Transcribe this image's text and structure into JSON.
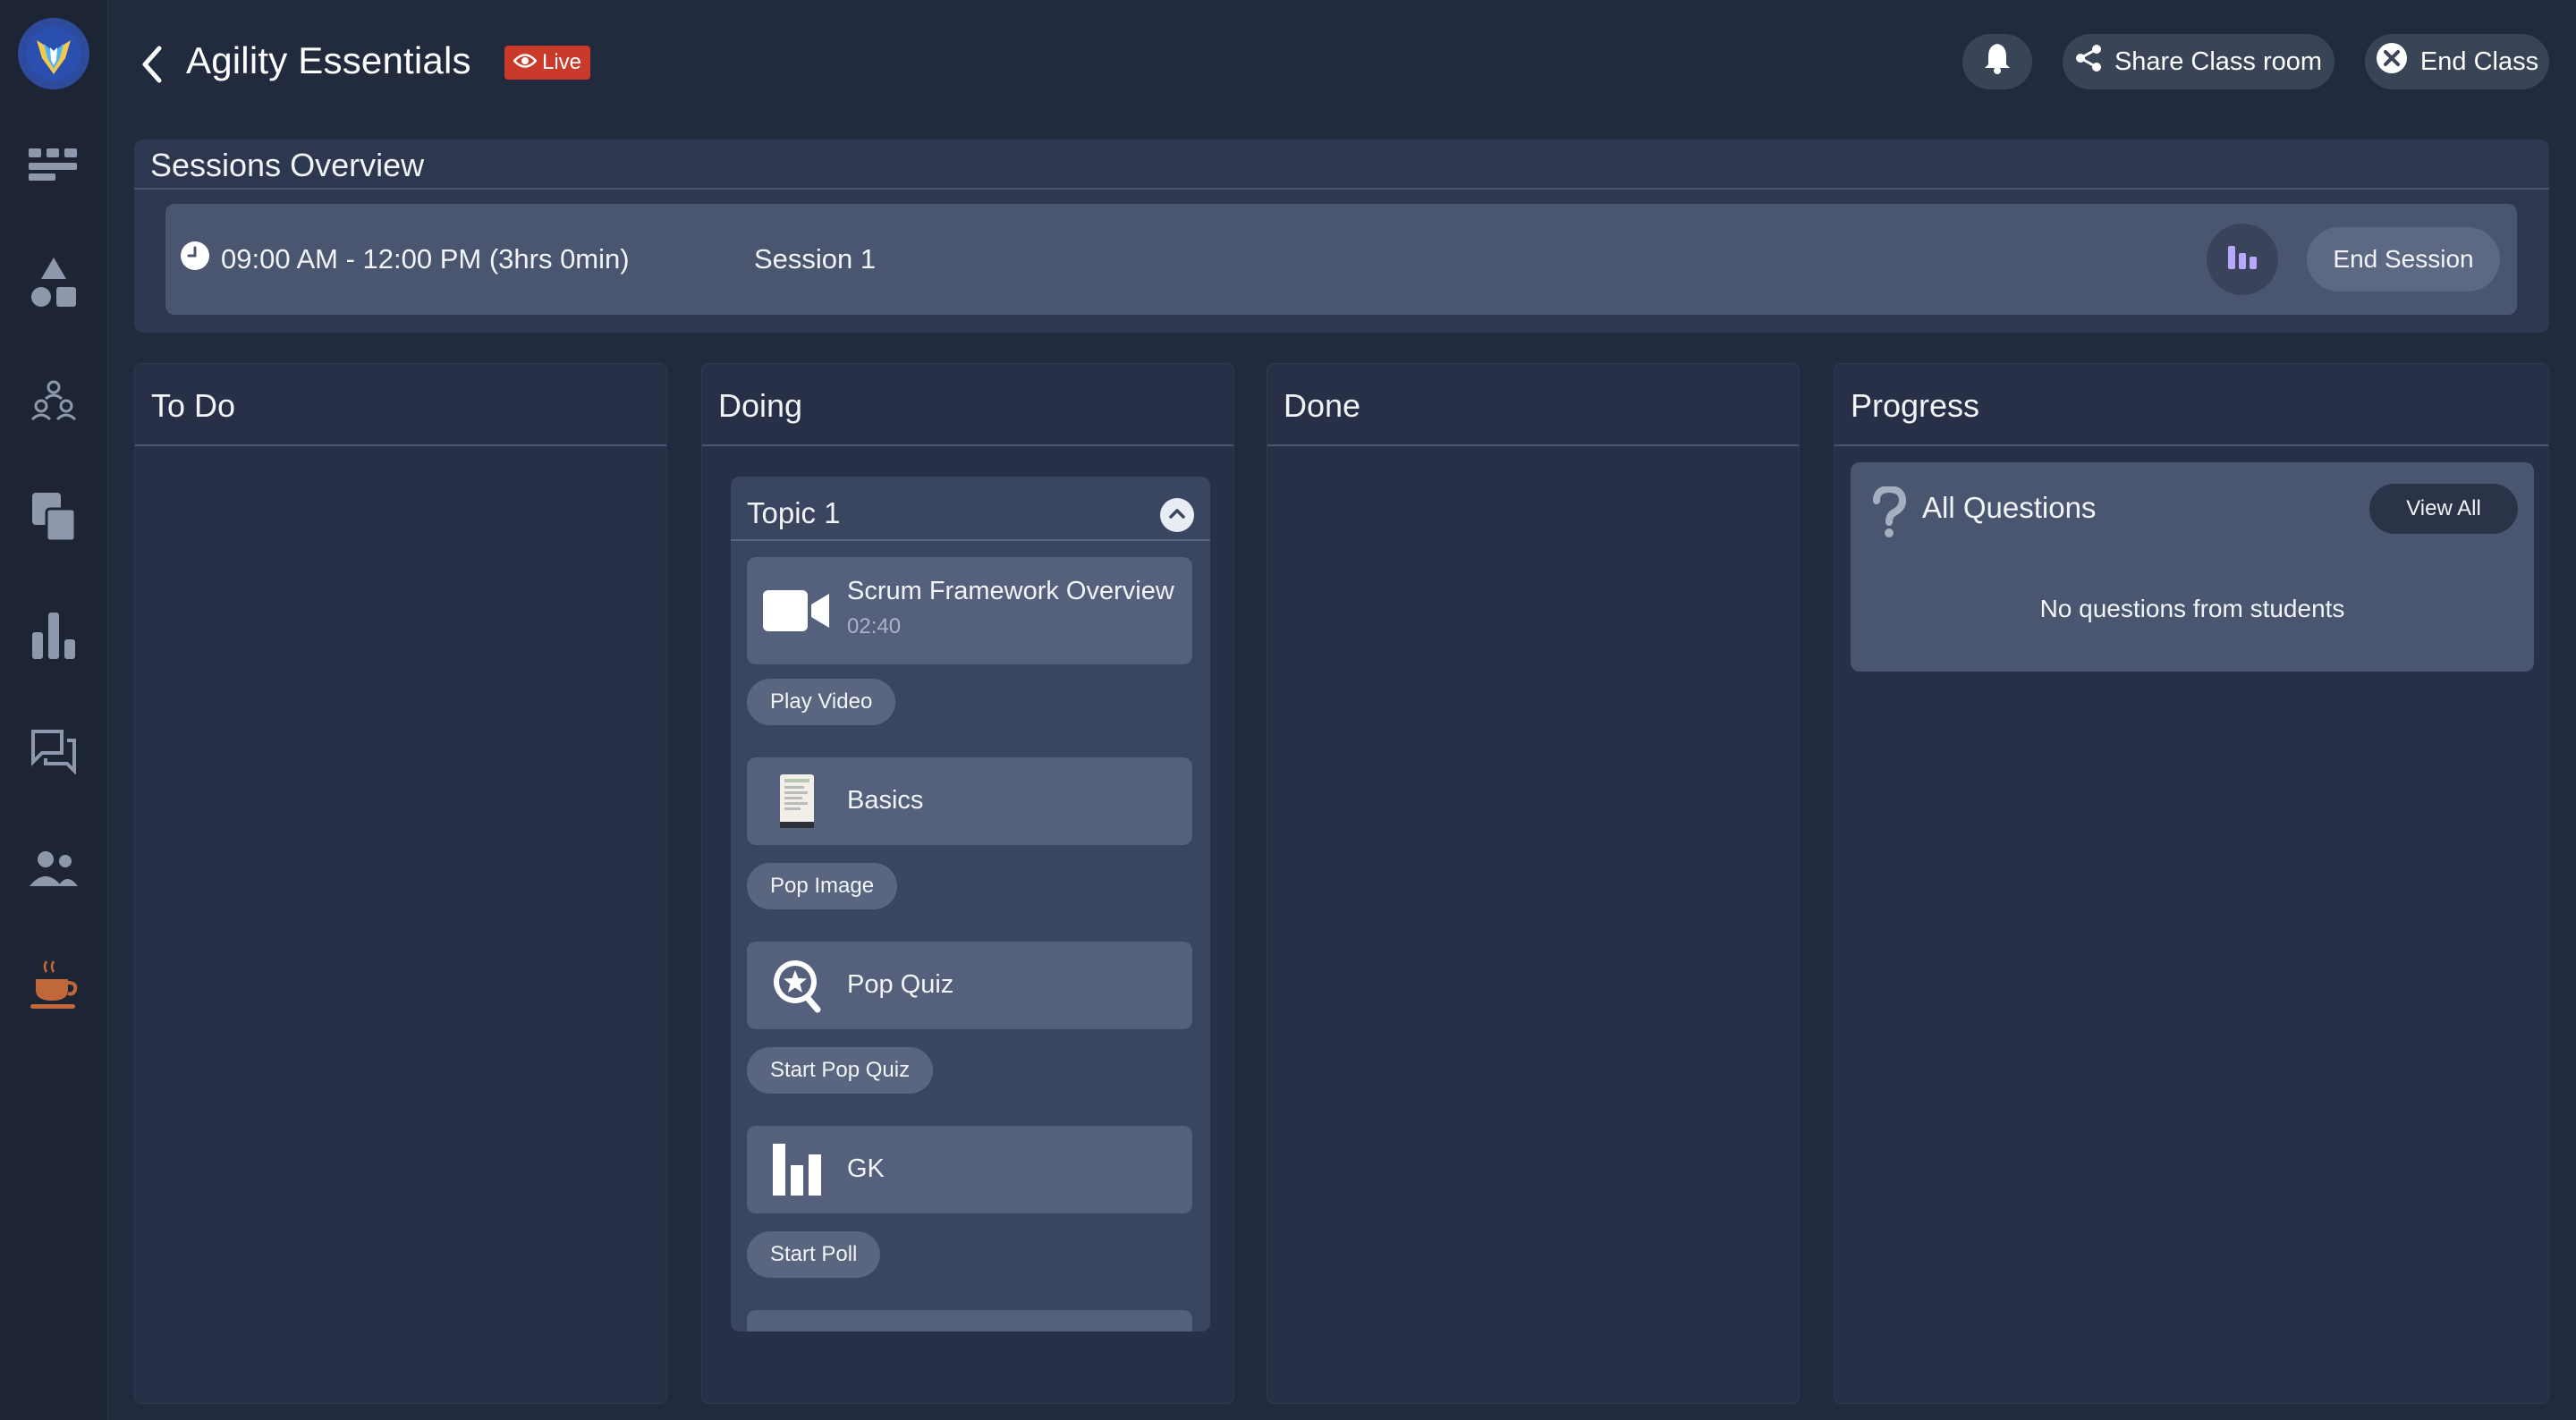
{
  "header": {
    "title": "Agility Essentials",
    "live_label": "Live",
    "share_label": "Share Class room",
    "end_class_label": "End Class"
  },
  "sidebar": {
    "items": [
      {
        "icon": "dashboard-icon"
      },
      {
        "icon": "shapes-icon"
      },
      {
        "icon": "groups-icon"
      },
      {
        "icon": "copy-icon"
      },
      {
        "icon": "bar-chart-icon"
      },
      {
        "icon": "chat-icon"
      },
      {
        "icon": "people-icon"
      },
      {
        "icon": "coffee-break-icon"
      }
    ]
  },
  "sessions": {
    "title": "Sessions Overview",
    "time": "09:00 AM - 12:00 PM (3hrs 0min)",
    "name": "Session 1",
    "end_label": "End Session"
  },
  "columns": {
    "todo": "To Do",
    "doing": "Doing",
    "done": "Done",
    "progress": "Progress"
  },
  "topic": {
    "title": "Topic 1",
    "items": [
      {
        "icon": "video-camera-icon",
        "label": "Scrum Framework Overview",
        "duration": "02:40",
        "action": "Play Video"
      },
      {
        "icon": "document-thumbnail-icon",
        "label": "Basics",
        "action": "Pop Image"
      },
      {
        "icon": "quiz-star-icon",
        "label": "Pop Quiz",
        "action": "Start Pop Quiz"
      },
      {
        "icon": "poll-icon",
        "label": "GK",
        "action": "Start Poll"
      }
    ]
  },
  "progress": {
    "questions_title": "All Questions",
    "view_all_label": "View All",
    "empty_text": "No questions from students"
  },
  "colors": {
    "background": "#222b3d",
    "sidebar": "#1d2535",
    "live": "#c93a2a",
    "accent_purple": "#b9a6ff"
  }
}
